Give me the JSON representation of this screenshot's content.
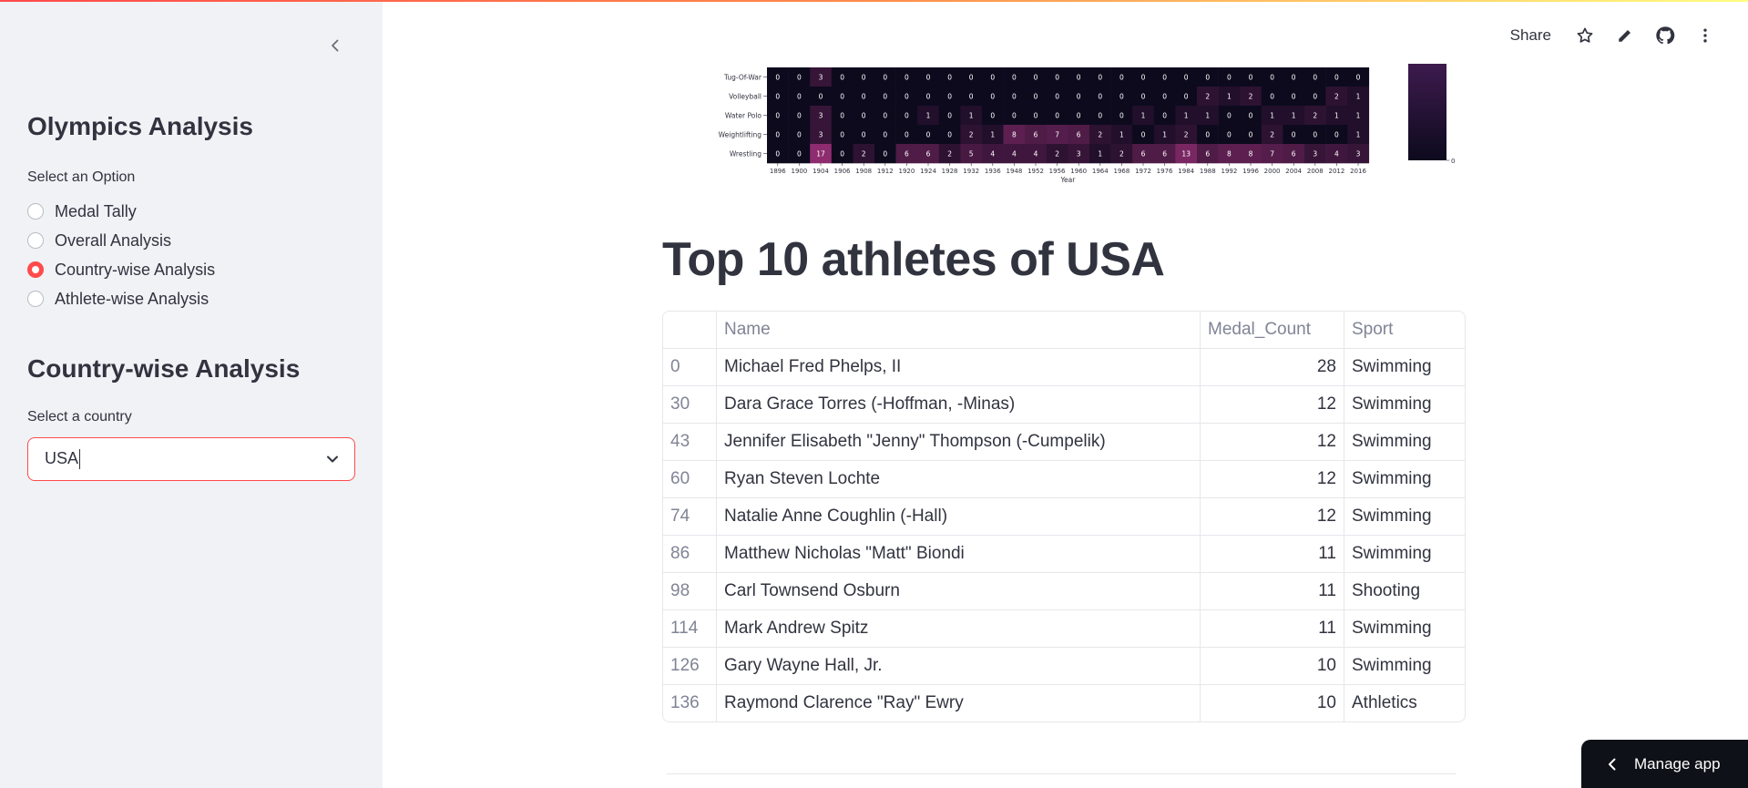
{
  "sidebar": {
    "title": "Olympics Analysis",
    "option_label": "Select an Option",
    "options": [
      {
        "label": "Medal Tally",
        "selected": false
      },
      {
        "label": "Overall Analysis",
        "selected": false
      },
      {
        "label": "Country-wise Analysis",
        "selected": true
      },
      {
        "label": "Athlete-wise Analysis",
        "selected": false
      }
    ],
    "section_title": "Country-wise Analysis",
    "country_label": "Select a country",
    "country_value": "USA"
  },
  "toolbar": {
    "share_label": "Share",
    "icons": [
      "star-icon",
      "edit-icon",
      "github-icon",
      "more-icon"
    ]
  },
  "chart_data": {
    "type": "heatmap",
    "xlabel": "Year",
    "ylabel": "",
    "x": [
      "1896",
      "1900",
      "1904",
      "1906",
      "1908",
      "1912",
      "1920",
      "1924",
      "1928",
      "1932",
      "1936",
      "1948",
      "1952",
      "1956",
      "1960",
      "1964",
      "1968",
      "1972",
      "1976",
      "1984",
      "1988",
      "1992",
      "1996",
      "2000",
      "2004",
      "2008",
      "2012",
      "2016"
    ],
    "y": [
      "Tug-Of-War",
      "Volleyball",
      "Water Polo",
      "Weightlifting",
      "Wrestling"
    ],
    "values": [
      [
        0,
        0,
        3,
        0,
        0,
        0,
        0,
        0,
        0,
        0,
        0,
        0,
        0,
        0,
        0,
        0,
        0,
        0,
        0,
        0,
        0,
        0,
        0,
        0,
        0,
        0,
        0,
        0
      ],
      [
        0,
        0,
        0,
        0,
        0,
        0,
        0,
        0,
        0,
        0,
        0,
        0,
        0,
        0,
        0,
        0,
        0,
        0,
        0,
        0,
        2,
        1,
        2,
        0,
        0,
        0,
        2,
        1,
        2
      ],
      [
        0,
        0,
        3,
        0,
        0,
        0,
        0,
        1,
        0,
        1,
        0,
        0,
        0,
        0,
        0,
        0,
        0,
        1,
        0,
        1,
        1,
        0,
        0,
        1,
        1,
        2,
        1,
        1
      ],
      [
        0,
        0,
        3,
        0,
        0,
        0,
        0,
        0,
        0,
        2,
        1,
        8,
        6,
        7,
        6,
        2,
        1,
        0,
        1,
        2,
        0,
        0,
        0,
        2,
        0,
        0,
        0,
        1
      ],
      [
        0,
        0,
        17,
        0,
        2,
        0,
        6,
        6,
        2,
        5,
        4,
        4,
        4,
        2,
        3,
        1,
        2,
        6,
        6,
        13,
        6,
        8,
        8,
        7,
        6,
        3,
        4,
        3
      ]
    ],
    "colorbar_min_label": "0",
    "colors": {
      "low": "#0d0a1e",
      "high": "#8e2c6f"
    }
  },
  "main": {
    "title": "Top 10 athletes of USA",
    "columns": [
      "",
      "Name",
      "Medal_Count",
      "Sport"
    ],
    "rows": [
      {
        "index": "0",
        "name": "Michael Fred Phelps, II",
        "count": "28",
        "sport": "Swimming"
      },
      {
        "index": "30",
        "name": "Dara Grace Torres (-Hoffman, -Minas)",
        "count": "12",
        "sport": "Swimming"
      },
      {
        "index": "43",
        "name": "Jennifer Elisabeth \"Jenny\" Thompson (-Cumpelik)",
        "count": "12",
        "sport": "Swimming"
      },
      {
        "index": "60",
        "name": "Ryan Steven Lochte",
        "count": "12",
        "sport": "Swimming"
      },
      {
        "index": "74",
        "name": "Natalie Anne Coughlin (-Hall)",
        "count": "12",
        "sport": "Swimming"
      },
      {
        "index": "86",
        "name": "Matthew Nicholas \"Matt\" Biondi",
        "count": "11",
        "sport": "Swimming"
      },
      {
        "index": "98",
        "name": "Carl Townsend Osburn",
        "count": "11",
        "sport": "Shooting"
      },
      {
        "index": "114",
        "name": "Mark Andrew Spitz",
        "count": "11",
        "sport": "Swimming"
      },
      {
        "index": "126",
        "name": "Gary Wayne Hall, Jr.",
        "count": "10",
        "sport": "Swimming"
      },
      {
        "index": "136",
        "name": "Raymond Clarence \"Ray\" Ewry",
        "count": "10",
        "sport": "Athletics"
      }
    ]
  },
  "manage_app_label": "Manage app",
  "colors": {
    "accent": "#ff4b4b",
    "sidebar_bg": "#f0f2f6",
    "text": "#31333f"
  }
}
